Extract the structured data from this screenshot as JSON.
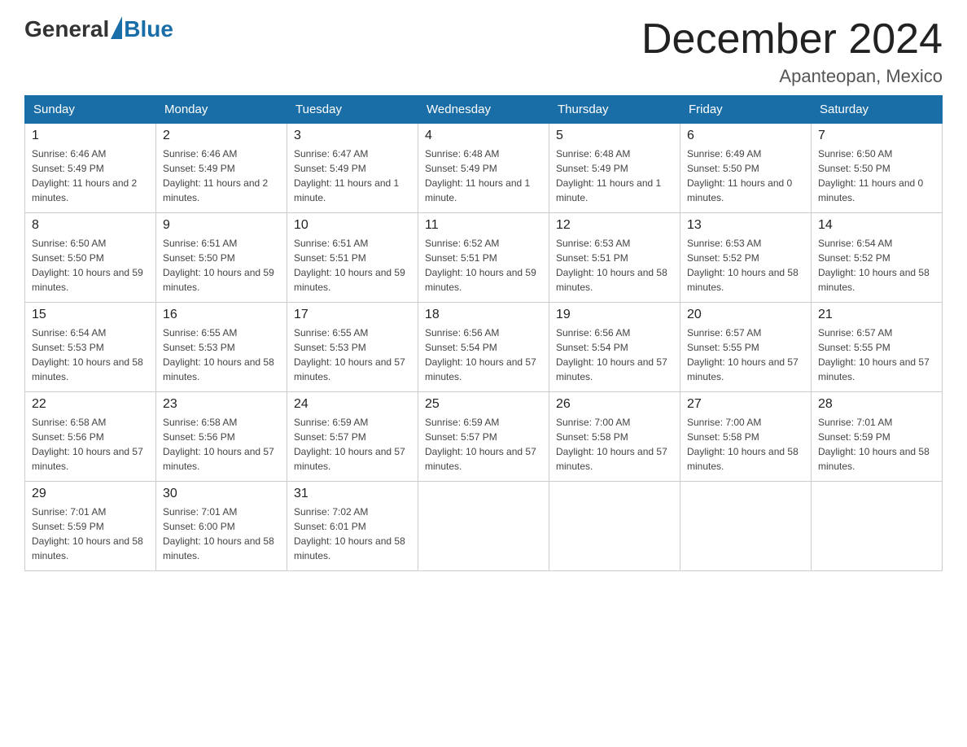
{
  "header": {
    "logo_general": "General",
    "logo_blue": "Blue",
    "month_title": "December 2024",
    "location": "Apanteopan, Mexico"
  },
  "days_of_week": [
    "Sunday",
    "Monday",
    "Tuesday",
    "Wednesday",
    "Thursday",
    "Friday",
    "Saturday"
  ],
  "weeks": [
    [
      {
        "day": 1,
        "sunrise": "6:46 AM",
        "sunset": "5:49 PM",
        "daylight": "11 hours and 2 minutes."
      },
      {
        "day": 2,
        "sunrise": "6:46 AM",
        "sunset": "5:49 PM",
        "daylight": "11 hours and 2 minutes."
      },
      {
        "day": 3,
        "sunrise": "6:47 AM",
        "sunset": "5:49 PM",
        "daylight": "11 hours and 1 minute."
      },
      {
        "day": 4,
        "sunrise": "6:48 AM",
        "sunset": "5:49 PM",
        "daylight": "11 hours and 1 minute."
      },
      {
        "day": 5,
        "sunrise": "6:48 AM",
        "sunset": "5:49 PM",
        "daylight": "11 hours and 1 minute."
      },
      {
        "day": 6,
        "sunrise": "6:49 AM",
        "sunset": "5:50 PM",
        "daylight": "11 hours and 0 minutes."
      },
      {
        "day": 7,
        "sunrise": "6:50 AM",
        "sunset": "5:50 PM",
        "daylight": "11 hours and 0 minutes."
      }
    ],
    [
      {
        "day": 8,
        "sunrise": "6:50 AM",
        "sunset": "5:50 PM",
        "daylight": "10 hours and 59 minutes."
      },
      {
        "day": 9,
        "sunrise": "6:51 AM",
        "sunset": "5:50 PM",
        "daylight": "10 hours and 59 minutes."
      },
      {
        "day": 10,
        "sunrise": "6:51 AM",
        "sunset": "5:51 PM",
        "daylight": "10 hours and 59 minutes."
      },
      {
        "day": 11,
        "sunrise": "6:52 AM",
        "sunset": "5:51 PM",
        "daylight": "10 hours and 59 minutes."
      },
      {
        "day": 12,
        "sunrise": "6:53 AM",
        "sunset": "5:51 PM",
        "daylight": "10 hours and 58 minutes."
      },
      {
        "day": 13,
        "sunrise": "6:53 AM",
        "sunset": "5:52 PM",
        "daylight": "10 hours and 58 minutes."
      },
      {
        "day": 14,
        "sunrise": "6:54 AM",
        "sunset": "5:52 PM",
        "daylight": "10 hours and 58 minutes."
      }
    ],
    [
      {
        "day": 15,
        "sunrise": "6:54 AM",
        "sunset": "5:53 PM",
        "daylight": "10 hours and 58 minutes."
      },
      {
        "day": 16,
        "sunrise": "6:55 AM",
        "sunset": "5:53 PM",
        "daylight": "10 hours and 58 minutes."
      },
      {
        "day": 17,
        "sunrise": "6:55 AM",
        "sunset": "5:53 PM",
        "daylight": "10 hours and 57 minutes."
      },
      {
        "day": 18,
        "sunrise": "6:56 AM",
        "sunset": "5:54 PM",
        "daylight": "10 hours and 57 minutes."
      },
      {
        "day": 19,
        "sunrise": "6:56 AM",
        "sunset": "5:54 PM",
        "daylight": "10 hours and 57 minutes."
      },
      {
        "day": 20,
        "sunrise": "6:57 AM",
        "sunset": "5:55 PM",
        "daylight": "10 hours and 57 minutes."
      },
      {
        "day": 21,
        "sunrise": "6:57 AM",
        "sunset": "5:55 PM",
        "daylight": "10 hours and 57 minutes."
      }
    ],
    [
      {
        "day": 22,
        "sunrise": "6:58 AM",
        "sunset": "5:56 PM",
        "daylight": "10 hours and 57 minutes."
      },
      {
        "day": 23,
        "sunrise": "6:58 AM",
        "sunset": "5:56 PM",
        "daylight": "10 hours and 57 minutes."
      },
      {
        "day": 24,
        "sunrise": "6:59 AM",
        "sunset": "5:57 PM",
        "daylight": "10 hours and 57 minutes."
      },
      {
        "day": 25,
        "sunrise": "6:59 AM",
        "sunset": "5:57 PM",
        "daylight": "10 hours and 57 minutes."
      },
      {
        "day": 26,
        "sunrise": "7:00 AM",
        "sunset": "5:58 PM",
        "daylight": "10 hours and 57 minutes."
      },
      {
        "day": 27,
        "sunrise": "7:00 AM",
        "sunset": "5:58 PM",
        "daylight": "10 hours and 58 minutes."
      },
      {
        "day": 28,
        "sunrise": "7:01 AM",
        "sunset": "5:59 PM",
        "daylight": "10 hours and 58 minutes."
      }
    ],
    [
      {
        "day": 29,
        "sunrise": "7:01 AM",
        "sunset": "5:59 PM",
        "daylight": "10 hours and 58 minutes."
      },
      {
        "day": 30,
        "sunrise": "7:01 AM",
        "sunset": "6:00 PM",
        "daylight": "10 hours and 58 minutes."
      },
      {
        "day": 31,
        "sunrise": "7:02 AM",
        "sunset": "6:01 PM",
        "daylight": "10 hours and 58 minutes."
      },
      null,
      null,
      null,
      null
    ]
  ]
}
